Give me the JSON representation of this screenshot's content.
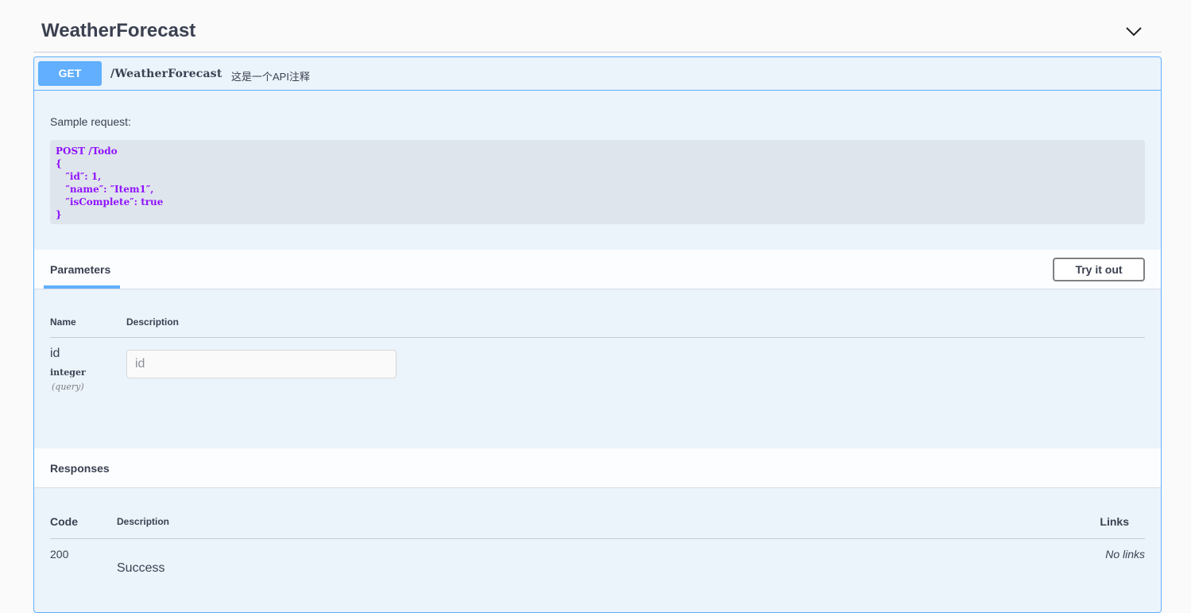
{
  "tag": {
    "title": "WeatherForecast",
    "toggle_icon": "chevron-down-icon"
  },
  "operation": {
    "method": "GET",
    "path": "/WeatherForecast",
    "summary": "这是一个API注释",
    "sample_label": "Sample request:",
    "sample_code": "POST /Todo\n{\n   ″id″: 1,\n   ″name″: ″Item1″,\n   ″isComplete″: true\n}"
  },
  "parameters": {
    "title": "Parameters",
    "try_button": "Try it out",
    "columns": {
      "name": "Name",
      "description": "Description"
    },
    "items": [
      {
        "name": "id",
        "type": "integer",
        "in": "(query)",
        "placeholder": "id"
      }
    ]
  },
  "responses": {
    "title": "Responses",
    "columns": {
      "code": "Code",
      "description": "Description",
      "links": "Links"
    },
    "items": [
      {
        "code": "200",
        "description": "Success",
        "links": "No links"
      }
    ]
  },
  "colors": {
    "get_method": "#61affe",
    "opblock_bg": "#ebf3fb",
    "code_text": "#9012fe",
    "text": "#3b4151"
  }
}
